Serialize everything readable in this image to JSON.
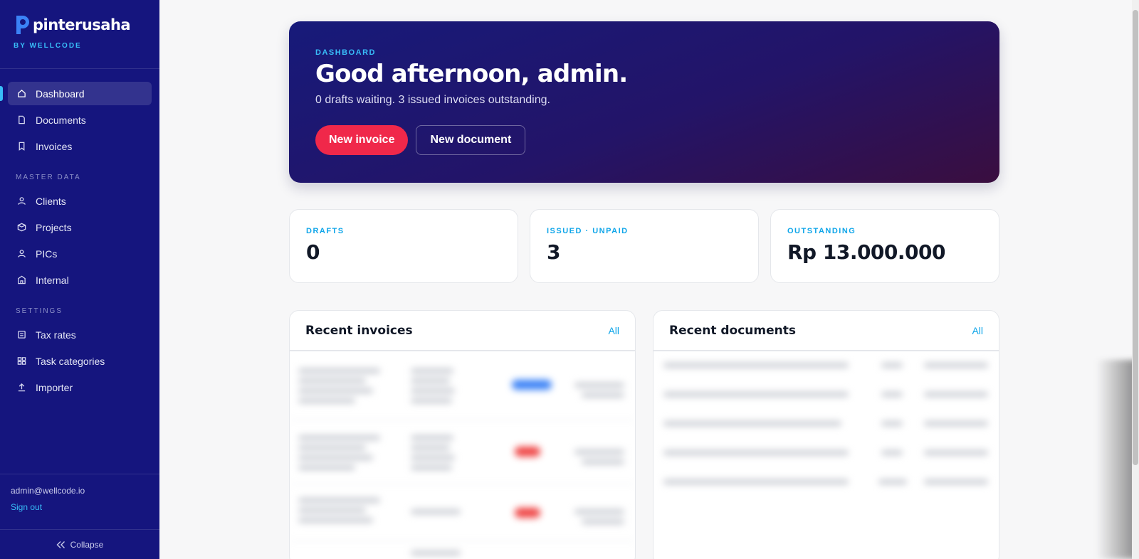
{
  "brand": {
    "name": "pinterusaha",
    "subtitle": "BY WELLCODE",
    "accent": "#38bdf8",
    "sidebar_bg": "#15157e"
  },
  "nav": {
    "main": [
      {
        "label": "Dashboard",
        "icon": "home-icon",
        "active": true
      },
      {
        "label": "Documents",
        "icon": "file-icon"
      },
      {
        "label": "Invoices",
        "icon": "bookmark-icon"
      }
    ],
    "master_title": "MASTER DATA",
    "master": [
      {
        "label": "Clients",
        "icon": "user-icon"
      },
      {
        "label": "Projects",
        "icon": "box-icon"
      },
      {
        "label": "PICs",
        "icon": "user-icon"
      },
      {
        "label": "Internal",
        "icon": "building-icon"
      }
    ],
    "settings_title": "SETTINGS",
    "settings": [
      {
        "label": "Tax rates",
        "icon": "receipt-icon"
      },
      {
        "label": "Task categories",
        "icon": "grid-icon"
      },
      {
        "label": "Importer",
        "icon": "upload-icon"
      }
    ]
  },
  "user": {
    "email": "admin@wellcode.io",
    "signout": "Sign out",
    "collapse": "Collapse"
  },
  "hero": {
    "eyebrow": "DASHBOARD",
    "title": "Good afternoon, admin.",
    "subtitle": "0 drafts waiting. 3 issued invoices outstanding.",
    "primary_btn": "New invoice",
    "secondary_btn": "New document"
  },
  "stats": [
    {
      "label": "DRAFTS",
      "value": "0"
    },
    {
      "label": "ISSUED · UNPAID",
      "value": "3"
    },
    {
      "label": "OUTSTANDING",
      "value": "Rp 13.000.000"
    }
  ],
  "panels": {
    "invoices": {
      "title": "Recent invoices",
      "link": "All"
    },
    "documents": {
      "title": "Recent documents",
      "link": "All"
    }
  },
  "colors": {
    "primary_button": "#f0284a",
    "status_blue": "#3b82f6",
    "status_red": "#ef4444"
  }
}
